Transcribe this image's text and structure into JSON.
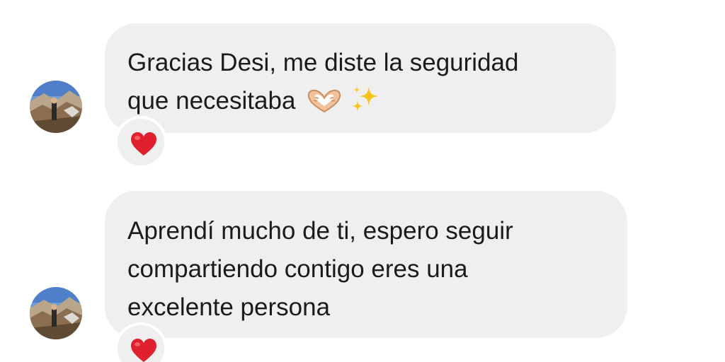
{
  "messages": [
    {
      "lines": [
        "Gracias Desi, me diste la seguridad",
        "que necesitaba"
      ],
      "emojis": [
        "heart-hands-icon",
        "sparkles-icon"
      ],
      "reaction": "heart-icon"
    },
    {
      "lines": [
        "Aprendí mucho de ti, espero seguir",
        "compartiendo contigo eres una",
        "excelente persona"
      ],
      "reaction": "heart-icon"
    }
  ],
  "colors": {
    "bubble": "#efefef",
    "text": "#1b1b1b",
    "reaction_heart": "#e0202c",
    "sparkle": "#f5c518"
  }
}
